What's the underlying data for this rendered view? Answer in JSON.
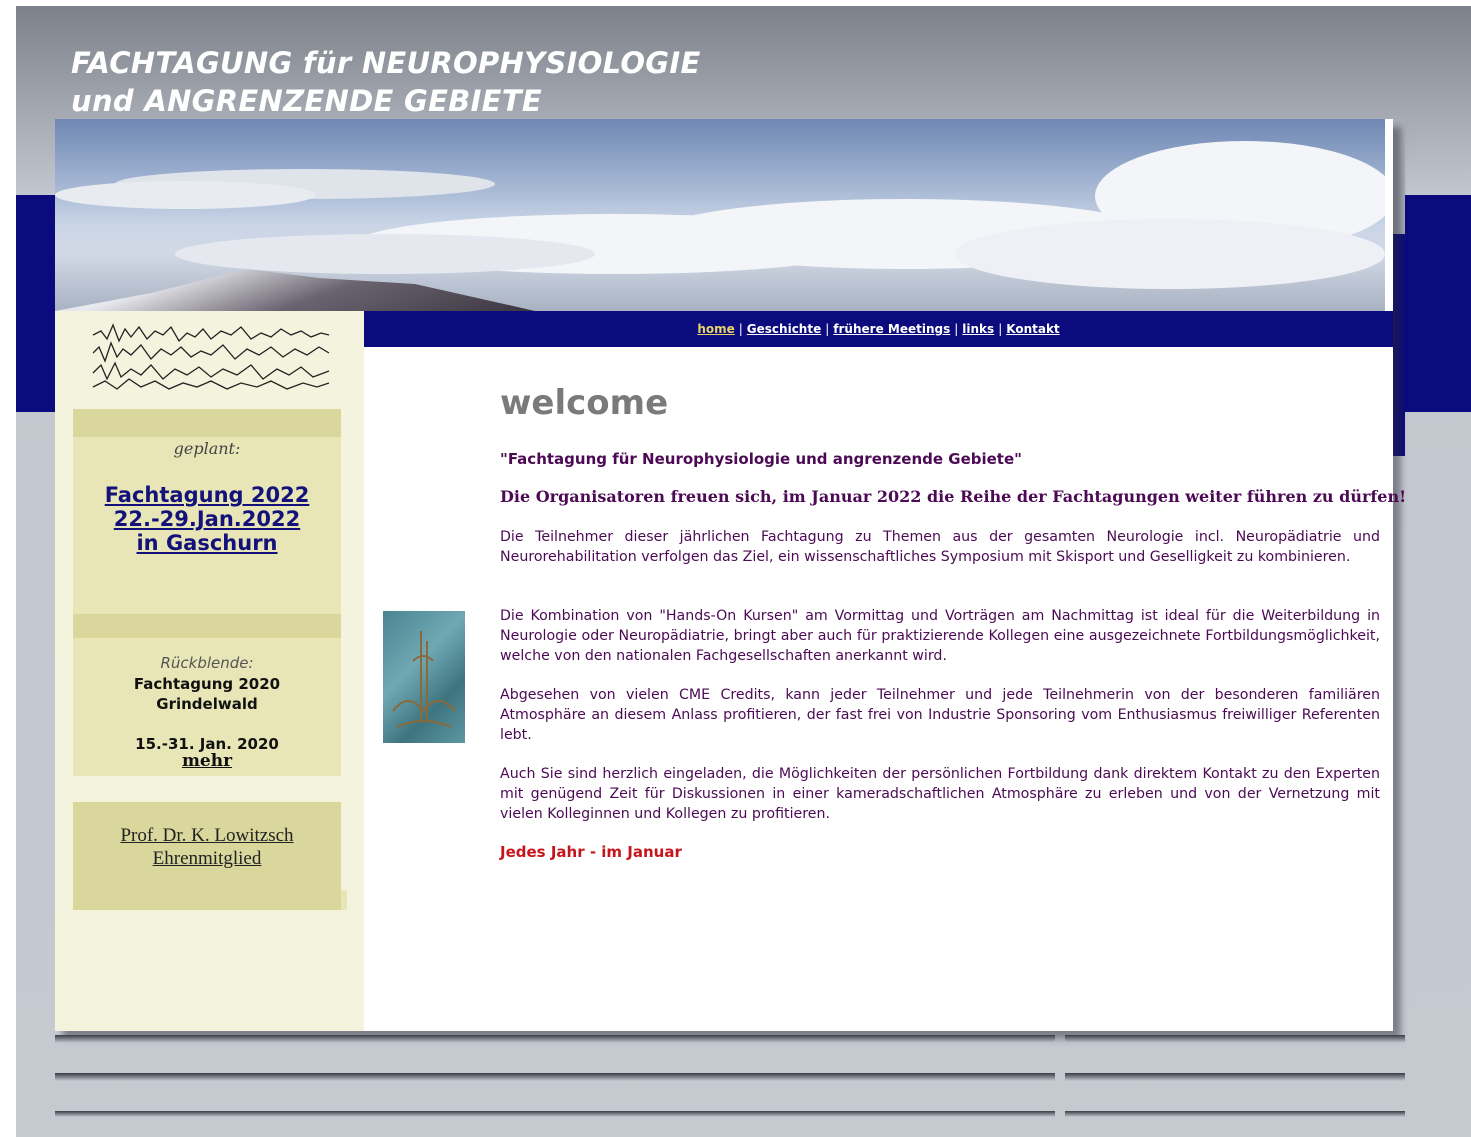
{
  "header": {
    "title_line1": "FACHTAGUNG für NEUROPHYSIOLOGIE",
    "title_line2": "und ANGRENZENDE GEBIETE"
  },
  "nav": {
    "items": [
      {
        "label": "home",
        "active": true
      },
      {
        "label": "Geschichte",
        "active": false
      },
      {
        "label": "frühere Meetings",
        "active": false
      },
      {
        "label": "links",
        "active": false
      },
      {
        "label": "Kontakt",
        "active": false
      }
    ]
  },
  "sidebar": {
    "planned": {
      "heading": "geplant:",
      "link_line1": "Fachtagung 2022",
      "link_line2": "22.-29.Jan.2022",
      "link_line3": "in Gaschurn"
    },
    "review": {
      "heading": "Rückblende:",
      "line1": "Fachtagung 2020",
      "line2": "Grindelwald",
      "dates": "15.-31. Jan. 2020",
      "more_link": "mehr"
    },
    "honorary": {
      "line1": "Prof. Dr. K. Lowitzsch",
      "line2": "Ehrenmitglied"
    }
  },
  "main": {
    "heading": "welcome",
    "quote_title": "\"Fachtagung für Neurophysiologie und angrenzende Gebiete\"",
    "organizers": "Die Organisatoren freuen sich, im Januar 2022 die Reihe der Fachtagungen weiter führen zu dürfen!",
    "paragraphs": [
      "Die Teilnehmer dieser jährlichen Fachtagung zu Themen aus der gesamten Neurologie incl. Neuropädiatrie und Neurorehabilitation verfolgen das Ziel, ein wissenschaftliches Symposium mit Skisport und Geselligkeit zu kombinieren.",
      "Die Kombination von \"Hands-On Kursen\" am Vormittag und Vorträgen am Nachmittag ist ideal für die Weiterbildung in Neurologie oder Neuropädiatrie, bringt aber auch für praktizierende Kollegen eine ausgezeichnete Fortbildungsmöglichkeit, welche von den nationalen Fachgesellschaften anerkannt wird.",
      "Abgesehen von vielen CME Credits, kann jeder Teilnehmer und jede Teilnehmerin von der besonderen familiären Atmosphäre an diesem Anlass profitieren, der fast frei von Industrie Sponsoring vom Enthusiasmus freiwilliger Referenten lebt.",
      "Auch Sie sind herzlich eingeladen, die Möglichkeiten der persönlichen Fortbildung dank direktem Kontakt zu den Experten mit genügend Zeit für Diskussionen in einer kameradschaftlichen Atmosphäre zu erleben und von der Vernetzung mit vielen Kolleginnen und Kollegen zu profitieren."
    ],
    "tagline": "Jedes Jahr - im Januar"
  },
  "colors": {
    "nav_bg": "#0c0b7d",
    "body_text": "#4c0a55",
    "accent_red": "#c4161c",
    "sidebar_box": "#e8e6b6"
  }
}
